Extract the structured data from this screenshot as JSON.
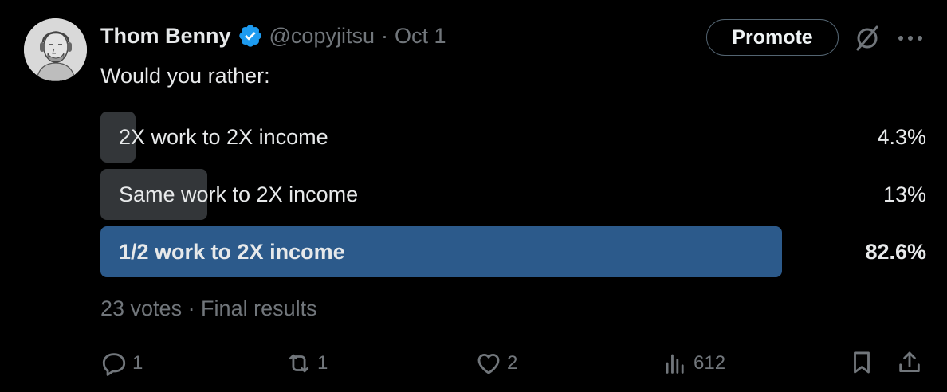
{
  "author": {
    "name": "Thom Benny",
    "handle": "@copyjitsu",
    "separator": "·",
    "date": "Oct 1",
    "avatar_icon": "person-avatar"
  },
  "buttons": {
    "promote": "Promote",
    "grok_icon": "grok-icon",
    "more_icon": "more-options-icon"
  },
  "tweet": {
    "text": "Would you rather:"
  },
  "poll": {
    "options": [
      {
        "label": "2X work to 2X income",
        "percent_text": "4.3%",
        "percent": 4.3,
        "winner": false
      },
      {
        "label": "Same work to 2X income",
        "percent_text": "13%",
        "percent": 13,
        "winner": false
      },
      {
        "label": "1/2 work to 2X income",
        "percent_text": "82.6%",
        "percent": 82.6,
        "winner": true
      }
    ],
    "summary": "23 votes · Final results"
  },
  "actions": {
    "replies": "1",
    "reposts": "1",
    "likes": "2",
    "views": "612"
  },
  "colors": {
    "background": "#000000",
    "winner_bar": "#2c5a8b",
    "loser_bar": "#333639",
    "verified_badge": "#1d9bf0",
    "muted_text": "#71767b"
  }
}
